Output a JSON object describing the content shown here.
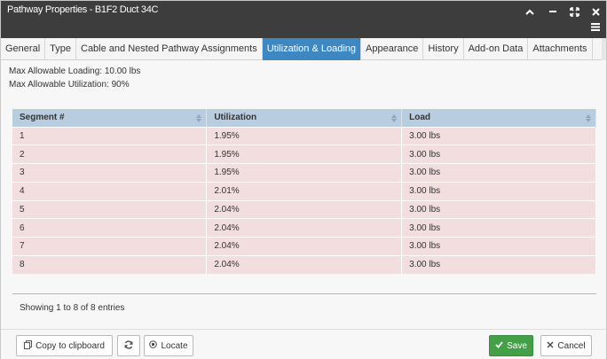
{
  "window": {
    "title": "Pathway Properties - B1F2 Duct 34C",
    "controls": [
      "chevron-up-icon",
      "minimize-icon",
      "fullscreen-icon",
      "close-icon",
      "menu-icon"
    ]
  },
  "tabs": [
    {
      "label": "General",
      "active": false
    },
    {
      "label": "Type",
      "active": false
    },
    {
      "label": "Cable and Nested Pathway Assignments",
      "active": false
    },
    {
      "label": "Utilization & Loading",
      "active": true
    },
    {
      "label": "Appearance",
      "active": false
    },
    {
      "label": "History",
      "active": false
    },
    {
      "label": "Add-on Data",
      "active": false
    },
    {
      "label": "Attachments",
      "active": false
    }
  ],
  "info": {
    "max_loading": "Max Allowable Loading: 10.00 lbs",
    "max_utilization": "Max Allowable Utilization: 90%"
  },
  "table": {
    "columns": [
      "Segment #",
      "Utilization",
      "Load"
    ],
    "rows": [
      [
        "1",
        "1.95%",
        "3.00 lbs"
      ],
      [
        "2",
        "1.95%",
        "3.00 lbs"
      ],
      [
        "3",
        "1.95%",
        "3.00 lbs"
      ],
      [
        "4",
        "2.01%",
        "3.00 lbs"
      ],
      [
        "5",
        "2.04%",
        "3.00 lbs"
      ],
      [
        "6",
        "2.04%",
        "3.00 lbs"
      ],
      [
        "7",
        "2.04%",
        "3.00 lbs"
      ],
      [
        "8",
        "2.04%",
        "3.00 lbs"
      ]
    ],
    "row_color": "#f2dede",
    "header_color": "#b8cde0"
  },
  "entries_text": "Showing 1 to 8 of 8 entries",
  "footer": {
    "copy_label": "Copy to clipboard",
    "locate_label": "Locate",
    "save_label": "Save",
    "cancel_label": "Cancel"
  },
  "colors": {
    "titlebar": "#3d3d3d",
    "active_tab": "#3d87c2",
    "save_button": "#43a047"
  }
}
